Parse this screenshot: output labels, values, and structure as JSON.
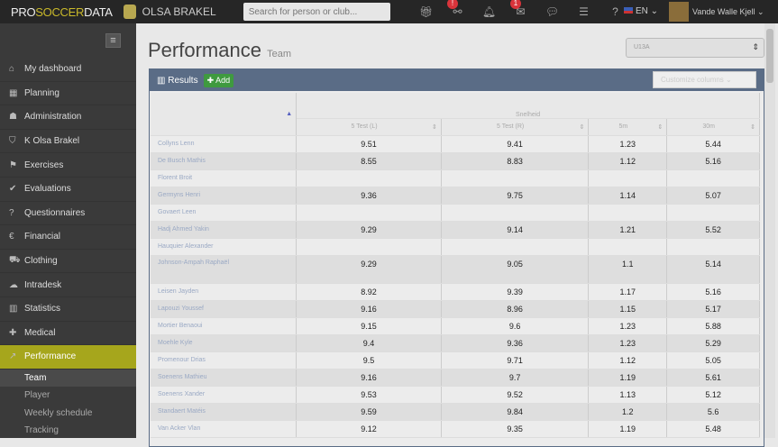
{
  "topbar": {
    "brand_pre": "PRO",
    "brand_mid": "SOCCER",
    "brand_post": "DATA",
    "club": "OLSA BRAKEL",
    "search_placeholder": "Search for person or club...",
    "badge1": "!",
    "badge2": "1",
    "help": "?",
    "lang": "EN",
    "user": "Vande Walle Kjell"
  },
  "sidebar": {
    "items": [
      {
        "icon": "⌂",
        "label": "My dashboard"
      },
      {
        "icon": "▦",
        "label": "Planning"
      },
      {
        "icon": "☗",
        "label": "Administration"
      },
      {
        "icon": "⛉",
        "label": "K Olsa Brakel"
      },
      {
        "icon": "⚑",
        "label": "Exercises"
      },
      {
        "icon": "✔",
        "label": "Evaluations"
      },
      {
        "icon": "?",
        "label": "Questionnaires"
      },
      {
        "icon": "€",
        "label": "Financial"
      },
      {
        "icon": "⛟",
        "label": "Clothing"
      },
      {
        "icon": "☁",
        "label": "Intradesk"
      },
      {
        "icon": "▥",
        "label": "Statistics"
      },
      {
        "icon": "✚",
        "label": "Medical"
      },
      {
        "icon": "↗",
        "label": "Performance"
      }
    ],
    "subitems": [
      "Team",
      "Player",
      "Weekly schedule",
      "Tracking"
    ]
  },
  "page": {
    "title": "Performance",
    "subtitle": "Team",
    "team_select": "U13A"
  },
  "panel": {
    "title": "Results",
    "add": "Add",
    "customize": "Customize columns"
  },
  "table": {
    "group": "Snelheid",
    "columns": [
      "5 Test (L)",
      "5 Test (R)",
      "5m",
      "30m"
    ],
    "rows": [
      {
        "name": "Collyns Lenn",
        "v": [
          "9.51",
          "9.41",
          "1.23",
          "5.44"
        ]
      },
      {
        "name": "De Busch Mathis",
        "v": [
          "8.55",
          "8.83",
          "1.12",
          "5.16"
        ]
      },
      {
        "name": "Florent Broit",
        "v": [
          "",
          "",
          "",
          ""
        ]
      },
      {
        "name": "Germyns Henri",
        "v": [
          "9.36",
          "9.75",
          "1.14",
          "5.07"
        ]
      },
      {
        "name": "Govaert Leen",
        "v": [
          "",
          "",
          "",
          ""
        ]
      },
      {
        "name": "Hadj Ahmed Yakin",
        "v": [
          "9.29",
          "9.14",
          "1.21",
          "5.52"
        ]
      },
      {
        "name": "Hauquier Alexander",
        "v": [
          "",
          "",
          "",
          ""
        ]
      },
      {
        "name": "Johnson-Ampah Raphaël",
        "v": [
          "9.29",
          "9.05",
          "1.1",
          "5.14"
        ]
      },
      {
        "name": "Leisen Jayden",
        "v": [
          "8.92",
          "9.39",
          "1.17",
          "5.16"
        ]
      },
      {
        "name": "Lapouzi Youssef",
        "v": [
          "9.16",
          "8.96",
          "1.15",
          "5.17"
        ]
      },
      {
        "name": "Mortier Benaoui",
        "v": [
          "9.15",
          "9.6",
          "1.23",
          "5.88"
        ]
      },
      {
        "name": "Moehle Kyle",
        "v": [
          "9.4",
          "9.36",
          "1.23",
          "5.29"
        ]
      },
      {
        "name": "Promenour Drias",
        "v": [
          "9.5",
          "9.71",
          "1.12",
          "5.05"
        ]
      },
      {
        "name": "Soenens Mathieu",
        "v": [
          "9.16",
          "9.7",
          "1.19",
          "5.61"
        ]
      },
      {
        "name": "Soenens Xander",
        "v": [
          "9.53",
          "9.52",
          "1.13",
          "5.12"
        ]
      },
      {
        "name": "Standaert Matéis",
        "v": [
          "9.59",
          "9.84",
          "1.2",
          "5.6"
        ]
      },
      {
        "name": "Van Acker Vlan",
        "v": [
          "9.12",
          "9.35",
          "1.19",
          "5.48"
        ]
      }
    ]
  }
}
